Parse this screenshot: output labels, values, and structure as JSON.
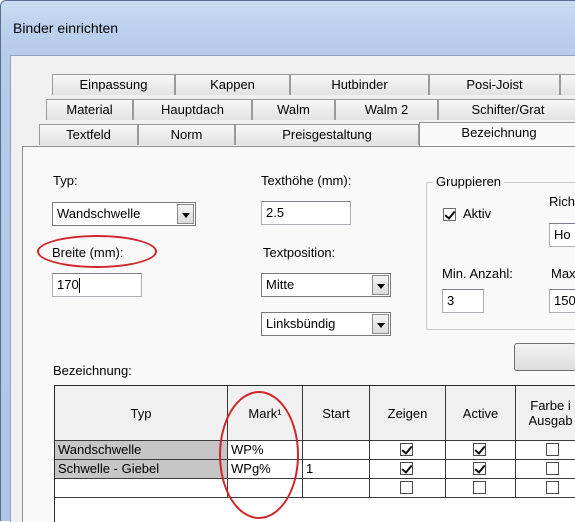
{
  "window": {
    "title": "Binder einrichten"
  },
  "tabs": {
    "row1": [
      "Einpassung",
      "Kappen",
      "Hutbinder",
      "Posi-Joist",
      ""
    ],
    "row2": [
      "Material",
      "Hauptdach",
      "Walm",
      "Walm 2",
      "Schifter/Grat"
    ],
    "row3": [
      "Textfeld",
      "Norm",
      "Preisgestaltung",
      "Bezeichnung"
    ],
    "active": "Bezeichnung"
  },
  "form": {
    "typ_label": "Typ:",
    "typ_value": "Wandschwelle",
    "breite_label": "Breite (mm):",
    "breite_value": "170",
    "texthoehe_label": "Texthöhe (mm):",
    "texthoehe_value": "2.5",
    "textposition_label": "Textposition:",
    "textposition_value": "Mitte",
    "ausrichtung_value": "Linksbündig",
    "gruppieren_label": "Gruppieren",
    "aktiv_label": "Aktiv",
    "aktiv_checked": true,
    "richtung_label": "Rich",
    "richtung_value": "Ho",
    "min_anzahl_label": "Min. Anzahl:",
    "min_anzahl_value": "3",
    "max_label": "Max",
    "max_value": "150",
    "bezeichnung_label": "Bezeichnung:"
  },
  "table": {
    "headers": [
      "Typ",
      "Mark¹",
      "Start",
      "Zeigen",
      "Active",
      "Farbe i\nAusgab"
    ],
    "rows": [
      {
        "typ": "Wandschwelle",
        "mark": "WP%",
        "start": "",
        "zeigen": true,
        "active": true,
        "farbe": false
      },
      {
        "typ": "Schwelle - Giebel",
        "mark": "WPg%",
        "start": "1",
        "zeigen": true,
        "active": true,
        "farbe": false
      },
      {
        "typ": "",
        "mark": "",
        "start": "",
        "zeigen": false,
        "active": false,
        "farbe": false
      }
    ]
  },
  "annotations": {
    "color": "#d0262b"
  }
}
